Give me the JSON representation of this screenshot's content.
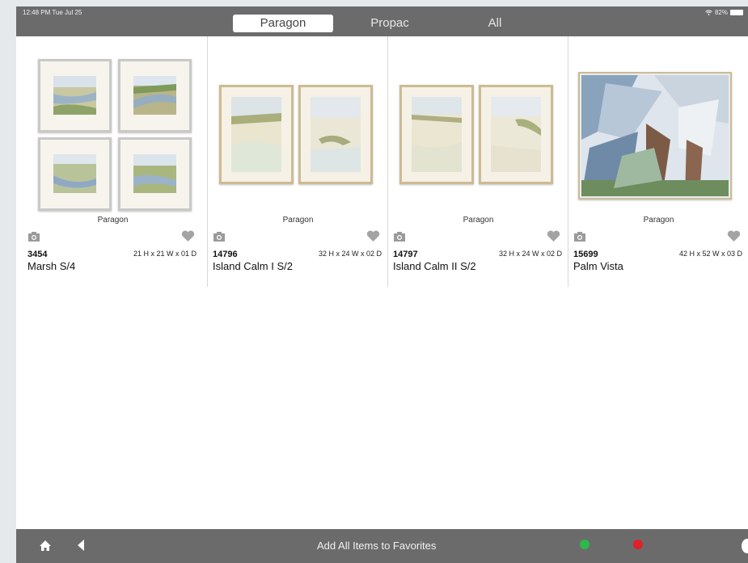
{
  "status": {
    "time": "12:48 PM  Tue Jul 25",
    "battery": "82%"
  },
  "segments": [
    {
      "label": "Paragon",
      "active": true
    },
    {
      "label": "Propac",
      "active": false
    },
    {
      "label": "All",
      "active": false
    }
  ],
  "products": [
    {
      "brand": "Paragon",
      "sku": "3454",
      "dims": "21 H x 21 W x 01 D",
      "name": "Marsh  S/4"
    },
    {
      "brand": "Paragon",
      "sku": "14796",
      "dims": "32 H x 24 W x 02 D",
      "name": "Island Calm I S/2"
    },
    {
      "brand": "Paragon",
      "sku": "14797",
      "dims": "32 H x 24 W x 02 D",
      "name": "Island Calm II S/2"
    },
    {
      "brand": "Paragon",
      "sku": "15699",
      "dims": "42 H x 52 W x 03 D",
      "name": "Palm Vista"
    }
  ],
  "bottom": {
    "add_all_label": "Add All Items to Favorites",
    "legend": [
      {
        "label": "",
        "color": "#2db84a"
      },
      {
        "label": "",
        "color": "#e0202a"
      }
    ]
  },
  "icons": {
    "home": "home-icon",
    "back": "back-arrow-icon",
    "camera": "camera-icon",
    "heart": "heart-icon",
    "wifi": "wifi-icon",
    "battery": "battery-icon"
  },
  "colors": {
    "bar": "#6b6b6b",
    "accent_green": "#2db84a",
    "accent_red": "#e0202a"
  }
}
